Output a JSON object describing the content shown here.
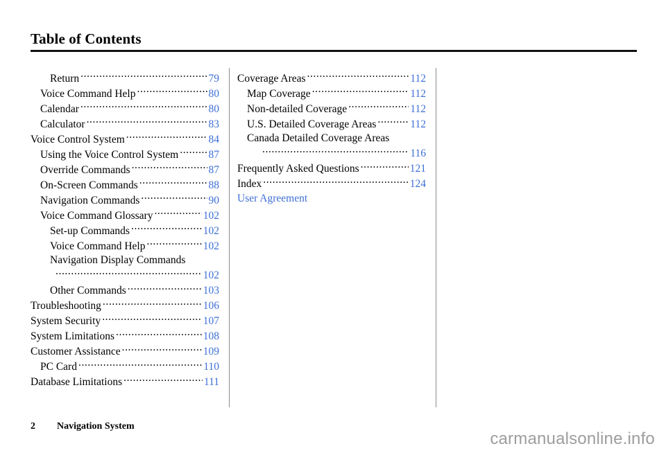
{
  "document": {
    "title": "Table of Contents",
    "accent_blue": "#3e6fd6",
    "rule_color": "#111111",
    "divider_color": "#8a8a8a"
  },
  "columns": {
    "left": [
      {
        "label": "Return",
        "page": "79",
        "level": 2
      },
      {
        "label": "Voice Command Help",
        "page": "80",
        "level": 1
      },
      {
        "label": "Calendar",
        "page": "80",
        "level": 1
      },
      {
        "label": "Calculator",
        "page": "83",
        "level": 1
      },
      {
        "label": "Voice Control System",
        "page": "84",
        "level": 0
      },
      {
        "label": "Using the Voice Control System",
        "page": "87",
        "level": 1
      },
      {
        "label": "Override Commands",
        "page": "87",
        "level": 1
      },
      {
        "label": "On-Screen Commands",
        "page": "88",
        "level": 1
      },
      {
        "label": "Navigation Commands",
        "page": "90",
        "level": 1
      },
      {
        "label": "Voice Command Glossary",
        "page": "102",
        "level": 1
      },
      {
        "label": "Set-up Commands",
        "page": "102",
        "level": 2
      },
      {
        "label": "Voice Command Help",
        "page": "102",
        "level": 2
      },
      {
        "label": "Navigation Display Commands",
        "page": "102",
        "level": 2,
        "wrapped": true
      },
      {
        "label": "Other Commands",
        "page": "103",
        "level": 2
      },
      {
        "label": "Troubleshooting",
        "page": "106",
        "level": 0
      },
      {
        "label": "System Security",
        "page": "107",
        "level": 0
      },
      {
        "label": "System Limitations",
        "page": "108",
        "level": 0
      },
      {
        "label": "Customer Assistance",
        "page": "109",
        "level": 0
      },
      {
        "label": "PC Card",
        "page": "110",
        "level": 1
      },
      {
        "label": "Database Limitations",
        "page": "111",
        "level": 0
      }
    ],
    "right": [
      {
        "label": "Coverage Areas",
        "page": "112",
        "level": 0
      },
      {
        "label": "Map Coverage",
        "page": "112",
        "level": 1
      },
      {
        "label": "Non-detailed Coverage",
        "page": "112",
        "level": 1
      },
      {
        "label": "U.S. Detailed Coverage Areas",
        "page": "112",
        "level": 1
      },
      {
        "label": "Canada Detailed Coverage Areas",
        "page": "116",
        "level": 1,
        "wrapped": true
      },
      {
        "label": "Frequently Asked Questions",
        "page": "121",
        "level": 0
      },
      {
        "label": "Index",
        "page": "124",
        "level": 0
      },
      {
        "label": "User Agreement",
        "page": "",
        "level": 0,
        "link_only": true
      }
    ]
  },
  "footer": {
    "page_number": "2",
    "section": "Navigation System"
  },
  "watermark": {
    "text": "carmanualsonline.info"
  }
}
